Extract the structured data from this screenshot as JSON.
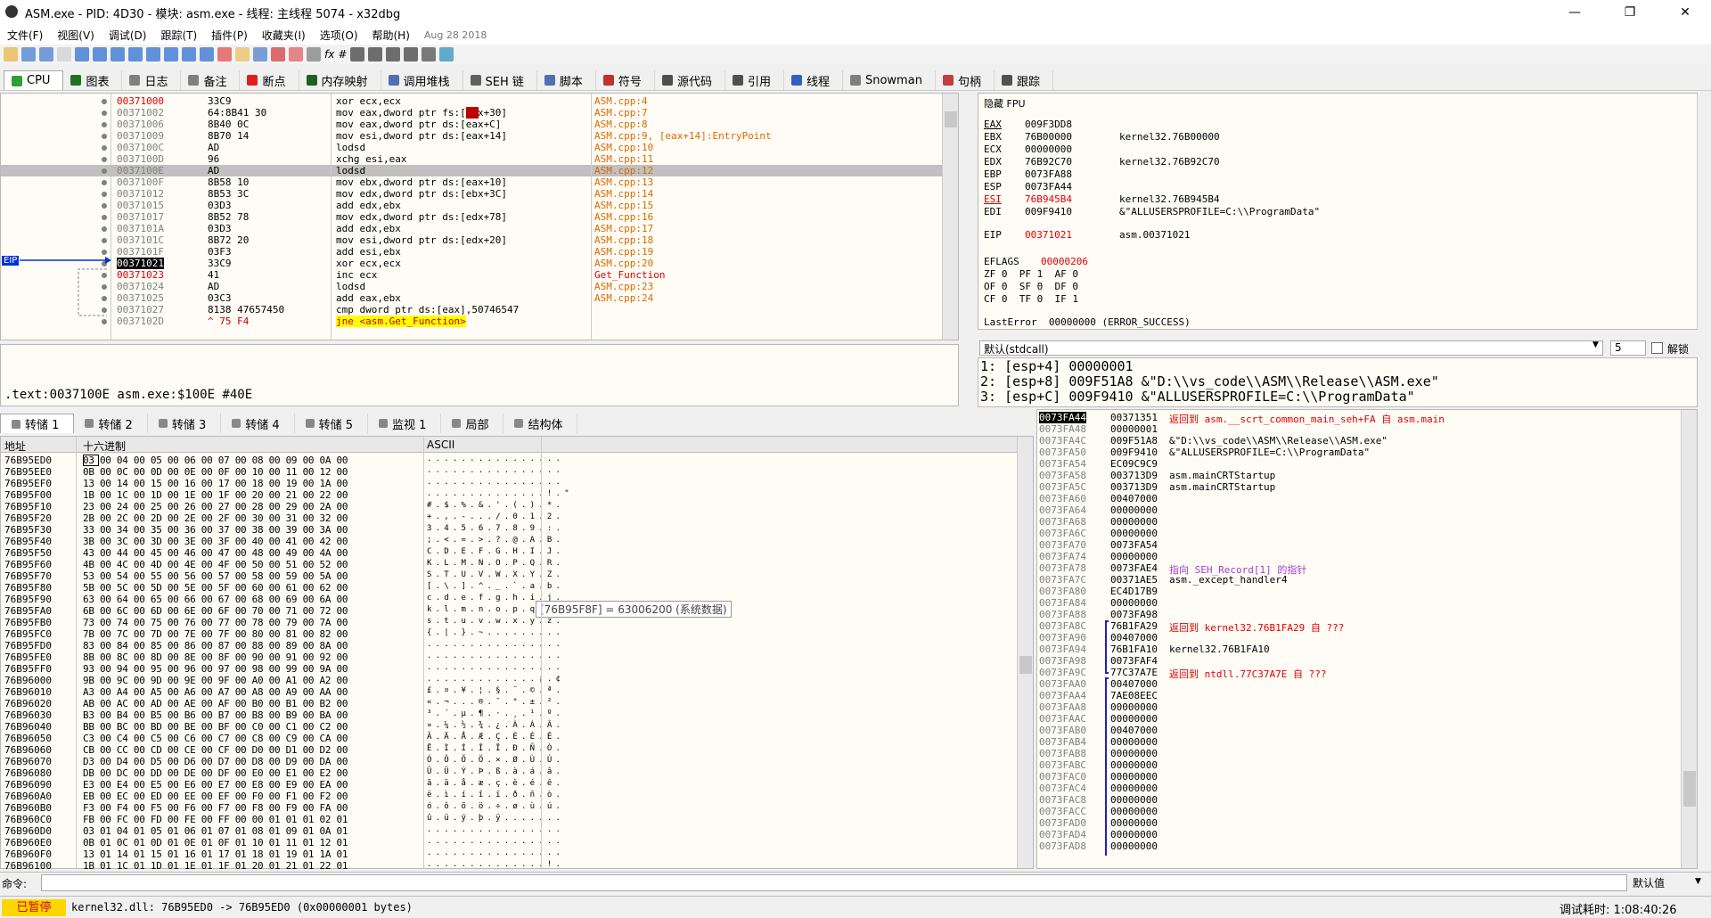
{
  "window": {
    "title": "ASM.exe - PID: 4D30 - 模块: asm.exe - 线程: 主线程 5074 - x32dbg",
    "min": "—",
    "max": "❐",
    "close": "✕"
  },
  "menu": {
    "items": [
      "文件(F)",
      "视图(V)",
      "调试(D)",
      "跟踪(T)",
      "插件(P)",
      "收藏夹(I)",
      "选项(O)",
      "帮助(H)"
    ],
    "date": "Aug 28 2018"
  },
  "toolbar": {
    "colors": [
      "#e8b44c",
      "#4a7fd0",
      "#4a7fd0",
      "#d0d0d0",
      "#3070d0",
      "#3070d0",
      "#3070d0",
      "#3070d0",
      "#3070d0",
      "#3070d0",
      "#3070d0",
      "#3070d0",
      "#e05050",
      "#e8c060",
      "#5080d0",
      "#d04040",
      "#e06060",
      "#808080",
      "#404040",
      "#404040",
      "#404040",
      "#404040",
      "#505050",
      "#3090c0"
    ],
    "glyphs": {
      "fx": "fx",
      "hash": "#",
      "az": "Aᵦ"
    }
  },
  "tabs": [
    {
      "label": "CPU",
      "icon": "cpu-icon",
      "color": "#30a030"
    },
    {
      "label": "图表",
      "icon": "graph-icon",
      "color": "#207020"
    },
    {
      "label": "日志",
      "icon": "log-icon",
      "color": "#808080"
    },
    {
      "label": "备注",
      "icon": "notes-icon",
      "color": "#808080"
    },
    {
      "label": "断点",
      "icon": "breakpoint-icon",
      "color": "#e02020"
    },
    {
      "label": "内存映射",
      "icon": "memory-map-icon",
      "color": "#206020"
    },
    {
      "label": "调用堆栈",
      "icon": "call-stack-icon",
      "color": "#5070b0"
    },
    {
      "label": "SEH 链",
      "icon": "seh-icon",
      "color": "#606060"
    },
    {
      "label": "脚本",
      "icon": "script-icon",
      "color": "#5070b0"
    },
    {
      "label": "符号",
      "icon": "symbols-icon",
      "color": "#c03030"
    },
    {
      "label": "源代码",
      "icon": "source-icon",
      "color": "#505050"
    },
    {
      "label": "引用",
      "icon": "references-icon",
      "color": "#505050"
    },
    {
      "label": "线程",
      "icon": "threads-icon",
      "color": "#3060c0"
    },
    {
      "label": "Snowman",
      "icon": "snowman-icon",
      "color": "#808080"
    },
    {
      "label": "句柄",
      "icon": "handles-icon",
      "color": "#c04040"
    },
    {
      "label": "跟踪",
      "icon": "trace-icon",
      "color": "#505050"
    }
  ],
  "eip_label": "EIP",
  "disasm": [
    {
      "addr": "00371000",
      "bytes": "33C9",
      "instr": "xor ecx,ecx",
      "com": "ASM.cpp:4",
      "red": true
    },
    {
      "addr": "00371002",
      "bytes": "64:8B41 30",
      "instr": "mov eax,dword ptr fs:[ecx+30]",
      "com": "ASM.cpp:7"
    },
    {
      "addr": "00371006",
      "bytes": "8B40 0C",
      "instr": "mov eax,dword ptr ds:[eax+C]",
      "com": "ASM.cpp:8"
    },
    {
      "addr": "00371009",
      "bytes": "8B70 14",
      "instr": "mov esi,dword ptr ds:[eax+14]",
      "com": "ASM.cpp:9, [eax+14]:EntryPoint"
    },
    {
      "addr": "0037100C",
      "bytes": "AD",
      "instr": "lodsd",
      "com": "ASM.cpp:10"
    },
    {
      "addr": "0037100D",
      "bytes": "96",
      "instr": "xchg esi,eax",
      "com": "ASM.cpp:11"
    },
    {
      "addr": "0037100E",
      "bytes": "AD",
      "instr": "lodsd",
      "com": "ASM.cpp:12",
      "sel": true
    },
    {
      "addr": "0037100F",
      "bytes": "8B58 10",
      "instr": "mov ebx,dword ptr ds:[eax+10]",
      "com": "ASM.cpp:13"
    },
    {
      "addr": "00371012",
      "bytes": "8B53 3C",
      "instr": "mov edx,dword ptr ds:[ebx+3C]",
      "com": "ASM.cpp:14"
    },
    {
      "addr": "00371015",
      "bytes": "03D3",
      "instr": "add edx,ebx",
      "com": "ASM.cpp:15"
    },
    {
      "addr": "00371017",
      "bytes": "8B52 78",
      "instr": "mov edx,dword ptr ds:[edx+78]",
      "com": "ASM.cpp:16"
    },
    {
      "addr": "0037101A",
      "bytes": "03D3",
      "instr": "add edx,ebx",
      "com": "ASM.cpp:17"
    },
    {
      "addr": "0037101C",
      "bytes": "8B72 20",
      "instr": "mov esi,dword ptr ds:[edx+20]",
      "com": "ASM.cpp:18"
    },
    {
      "addr": "0037101F",
      "bytes": "03F3",
      "instr": "add esi,ebx",
      "com": "ASM.cpp:19"
    },
    {
      "addr": "00371021",
      "bytes": "33C9",
      "instr": "xor ecx,ecx",
      "com": "ASM.cpp:20",
      "eip": true
    },
    {
      "addr": "00371023",
      "bytes": "41",
      "instr": "inc ecx",
      "com": "Get_Function",
      "red": true
    },
    {
      "addr": "00371024",
      "bytes": "AD",
      "instr": "lodsd",
      "com": "ASM.cpp:23"
    },
    {
      "addr": "00371025",
      "bytes": "03C3",
      "instr": "add eax,ebx",
      "com": "ASM.cpp:24"
    },
    {
      "addr": "00371027",
      "bytes": "8138 47657450",
      "instr": "cmp dword ptr ds:[eax],50746547",
      "com": ""
    },
    {
      "addr": "0037102D",
      "bytes": "^ 75 F4",
      "instr": "jne <asm.Get_Function>",
      "com": "",
      "jump": true
    }
  ],
  "regs": {
    "header": "隐藏 FPU",
    "rows": [
      {
        "n": "EAX",
        "v": "009F3DD8",
        "c": ""
      },
      {
        "n": "EBX",
        "v": "76B00000",
        "c": "kernel32.76B00000"
      },
      {
        "n": "ECX",
        "v": "00000000",
        "c": ""
      },
      {
        "n": "EDX",
        "v": "76B92C70",
        "c": "kernel32.76B92C70"
      },
      {
        "n": "EBP",
        "v": "0073FA88",
        "c": ""
      },
      {
        "n": "ESP",
        "v": "0073FA44",
        "c": ""
      },
      {
        "n": "ESI",
        "v": "76B945B4",
        "c": "kernel32.76B945B4",
        "red": true
      },
      {
        "n": "EDI",
        "v": "009F9410",
        "c": "&\"ALLUSERSPROFILE=C:\\\\ProgramData\""
      }
    ],
    "eip": {
      "n": "EIP",
      "v": "00371021",
      "c": "asm.00371021"
    },
    "eflags": {
      "n": "EFLAGS",
      "v": "00000206"
    },
    "flags": [
      "ZF 0  PF 1  AF 0",
      "OF 0  SF 0  DF 0",
      "CF 0  TF 0  IF 1"
    ],
    "lasterror": "LastError  00000000 (ERROR_SUCCESS)"
  },
  "callconv": {
    "value": "默认(stdcall)",
    "count": "5",
    "lock": "解锁"
  },
  "args": [
    "1: [esp+4] 00000001",
    "2: [esp+8] 009F51A8 &\"D:\\\\vs_code\\\\ASM\\\\Release\\\\ASM.exe\"",
    "3: [esp+C] 009F9410 &\"ALLUSERSPROFILE=C:\\\\ProgramData\""
  ],
  "info": ".text:0037100E asm.exe:$100E #40E",
  "dumptabs": [
    {
      "label": "转储 1",
      "icon": "dump-icon"
    },
    {
      "label": "转储 2",
      "icon": "dump-icon"
    },
    {
      "label": "转储 3",
      "icon": "dump-icon"
    },
    {
      "label": "转储 4",
      "icon": "dump-icon"
    },
    {
      "label": "转储 5",
      "icon": "dump-icon"
    },
    {
      "label": "监视 1",
      "icon": "watch-icon"
    },
    {
      "label": "局部",
      "icon": "locals-icon"
    },
    {
      "label": "结构体",
      "icon": "struct-icon"
    }
  ],
  "dump": {
    "headers": {
      "addr": "地址",
      "hex": "十六进制",
      "ascii": "ASCII"
    },
    "tooltip": "[76B95F8F] = 63006200 (系统数据)",
    "rows": [
      [
        "76B95ED0",
        "03 00 04 00 05 00 06 00 07 00 08 00 09 00 0A 00",
        ". . . . . . . . . . . . . . . ."
      ],
      [
        "76B95EE0",
        "0B 00 0C 00 0D 00 0E 00 0F 00 10 00 11 00 12 00",
        ". . . . . . . . . . . . . . . ."
      ],
      [
        "76B95EF0",
        "13 00 14 00 15 00 16 00 17 00 18 00 19 00 1A 00",
        ". . . . . . . . . . . . . . . ."
      ],
      [
        "76B95F00",
        "1B 00 1C 00 1D 00 1E 00 1F 00 20 00 21 00 22 00",
        ". . . . . . . . . . . . . . ! . \""
      ],
      [
        "76B95F10",
        "23 00 24 00 25 00 26 00 27 00 28 00 29 00 2A 00",
        "# . $ . % . & . ' . ( . ) . * ."
      ],
      [
        "76B95F20",
        "2B 00 2C 00 2D 00 2E 00 2F 00 30 00 31 00 32 00",
        "+ . , . - . . . / . 0 . 1 . 2 ."
      ],
      [
        "76B95F30",
        "33 00 34 00 35 00 36 00 37 00 38 00 39 00 3A 00",
        "3 . 4 . 5 . 6 . 7 . 8 . 9 . : ."
      ],
      [
        "76B95F40",
        "3B 00 3C 00 3D 00 3E 00 3F 00 40 00 41 00 42 00",
        "; . < . = . > . ? . @ . A . B ."
      ],
      [
        "76B95F50",
        "43 00 44 00 45 00 46 00 47 00 48 00 49 00 4A 00",
        "C . D . E . F . G . H . I . J ."
      ],
      [
        "76B95F60",
        "4B 00 4C 00 4D 00 4E 00 4F 00 50 00 51 00 52 00",
        "K . L . M . N . O . P . Q . R ."
      ],
      [
        "76B95F70",
        "53 00 54 00 55 00 56 00 57 00 58 00 59 00 5A 00",
        "S . T . U . V . W . X . Y . Z ."
      ],
      [
        "76B95F80",
        "5B 00 5C 00 5D 00 5E 00 5F 00 60 00 61 00 62 00",
        "[ . \\ . ] . ^ . _ . ` . a . b ."
      ],
      [
        "76B95F90",
        "63 00 64 00 65 00 66 00 67 00 68 00 69 00 6A 00",
        "c . d . e . f . g . h . i . j ."
      ],
      [
        "76B95FA0",
        "6B 00 6C 00 6D 00 6E 00 6F 00 70 00 71 00 72 00",
        "k . l . m . n . o . p . q . r ."
      ],
      [
        "76B95FB0",
        "73 00 74 00 75 00 76 00 77 00 78 00 79 00 7A 00",
        "s . t . u . v . w . x . y . z ."
      ],
      [
        "76B95FC0",
        "7B 00 7C 00 7D 00 7E 00 7F 00 80 00 81 00 82 00",
        "{ . | . } . ~ . . . . . . . . ."
      ],
      [
        "76B95FD0",
        "83 00 84 00 85 00 86 00 87 00 88 00 89 00 8A 00",
        ". . . . . . . . . . . . . . . ."
      ],
      [
        "76B95FE0",
        "8B 00 8C 00 8D 00 8E 00 8F 00 90 00 91 00 92 00",
        ". . . . . . . . . . . . . . . ."
      ],
      [
        "76B95FF0",
        "93 00 94 00 95 00 96 00 97 00 98 00 99 00 9A 00",
        ". . . . . . . . . . . . . . . ."
      ],
      [
        "76B96000",
        "9B 00 9C 00 9D 00 9E 00 9F 00 A0 00 A1 00 A2 00",
        ". . . . . . . . . . . . . ¡ . ¢"
      ],
      [
        "76B96010",
        "A3 00 A4 00 A5 00 A6 00 A7 00 A8 00 A9 00 AA 00",
        "£ . ¤ . ¥ . ¦ . § . ¨ . © . ª ."
      ],
      [
        "76B96020",
        "AB 00 AC 00 AD 00 AE 00 AF 00 B0 00 B1 00 B2 00",
        "« . ¬ . . . ® . ¯ . ° . ± . ² ."
      ],
      [
        "76B96030",
        "B3 00 B4 00 B5 00 B6 00 B7 00 B8 00 B9 00 BA 00",
        "³ . ´ . µ . ¶ . · . ¸ . ¹ . º ."
      ],
      [
        "76B96040",
        "BB 00 BC 00 BD 00 BE 00 BF 00 C0 00 C1 00 C2 00",
        "» . ¼ . ½ . ¾ . ¿ . À . Á . Â ."
      ],
      [
        "76B96050",
        "C3 00 C4 00 C5 00 C6 00 C7 00 C8 00 C9 00 CA 00",
        "Ã . Ä . Å . Æ . Ç . È . É . Ê ."
      ],
      [
        "76B96060",
        "CB 00 CC 00 CD 00 CE 00 CF 00 D0 00 D1 00 D2 00",
        "Ë . Ì . Í . Î . Ï . Ð . Ñ . Ò ."
      ],
      [
        "76B96070",
        "D3 00 D4 00 D5 00 D6 00 D7 00 D8 00 D9 00 DA 00",
        "Ó . Ô . Õ . Ö . × . Ø . Ù . Ú ."
      ],
      [
        "76B96080",
        "DB 00 DC 00 DD 00 DE 00 DF 00 E0 00 E1 00 E2 00",
        "Û . Ü . Ý . Þ . ß . à . á . â ."
      ],
      [
        "76B96090",
        "E3 00 E4 00 E5 00 E6 00 E7 00 E8 00 E9 00 EA 00",
        "ã . ä . å . æ . ç . è . é . ê ."
      ],
      [
        "76B960A0",
        "EB 00 EC 00 ED 00 EE 00 EF 00 F0 00 F1 00 F2 00",
        "ë . ì . í . î . ï . ð . ñ . ò ."
      ],
      [
        "76B960B0",
        "F3 00 F4 00 F5 00 F6 00 F7 00 F8 00 F9 00 FA 00",
        "ó . ô . õ . ö . ÷ . ø . ù . ú ."
      ],
      [
        "76B960C0",
        "FB 00 FC 00 FD 00 FE 00 FF 00 00 01 01 01 02 01",
        "û . ü . ý . þ . ÿ . . . . . . ."
      ],
      [
        "76B960D0",
        "03 01 04 01 05 01 06 01 07 01 08 01 09 01 0A 01",
        ". . . . . . . . . . . . . . . ."
      ],
      [
        "76B960E0",
        "0B 01 0C 01 0D 01 0E 01 0F 01 10 01 11 01 12 01",
        ". . . . . . . . . . . . . . . ."
      ],
      [
        "76B960F0",
        "13 01 14 01 15 01 16 01 17 01 18 01 19 01 1A 01",
        ". . . . . . . . . . . . . . . ."
      ],
      [
        "76B96100",
        "1B 01 1C 01 1D 01 1E 01 1F 01 20 01 21 01 22 01",
        ". . . . . . . . . . . . . . ! ."
      ]
    ]
  },
  "stack": [
    {
      "a": "0073FA44",
      "v": "00371351",
      "c": "返回到 asm.__scrt_common_main_seh+FA 自 asm.main",
      "t": "ret",
      "sel": true
    },
    {
      "a": "0073FA48",
      "v": "00000001",
      "c": ""
    },
    {
      "a": "0073FA4C",
      "v": "009F51A8",
      "c": "&\"D:\\\\vs_code\\\\ASM\\\\Release\\\\ASM.exe\""
    },
    {
      "a": "0073FA50",
      "v": "009F9410",
      "c": "&\"ALLUSERSPROFILE=C:\\\\ProgramData\""
    },
    {
      "a": "0073FA54",
      "v": "EC09C9C9",
      "c": ""
    },
    {
      "a": "0073FA58",
      "v": "003713D9",
      "c": "asm.mainCRTStartup"
    },
    {
      "a": "0073FA5C",
      "v": "003713D9",
      "c": "asm.mainCRTStartup"
    },
    {
      "a": "0073FA60",
      "v": "00407000",
      "c": ""
    },
    {
      "a": "0073FA64",
      "v": "00000000",
      "c": ""
    },
    {
      "a": "0073FA68",
      "v": "00000000",
      "c": ""
    },
    {
      "a": "0073FA6C",
      "v": "00000000",
      "c": ""
    },
    {
      "a": "0073FA70",
      "v": "0073FA54",
      "c": ""
    },
    {
      "a": "0073FA74",
      "v": "00000000",
      "c": ""
    },
    {
      "a": "0073FA78",
      "v": "0073FAE4",
      "c": "指向 SEH_Record[1] 的指针",
      "t": "seh"
    },
    {
      "a": "0073FA7C",
      "v": "00371AE5",
      "c": "asm._except_handler4"
    },
    {
      "a": "0073FA80",
      "v": "EC4D17B9",
      "c": ""
    },
    {
      "a": "0073FA84",
      "v": "00000000",
      "c": ""
    },
    {
      "a": "0073FA88",
      "v": "0073FA98",
      "c": ""
    },
    {
      "a": "0073FA8C",
      "v": "76B1FA29",
      "c": "返回到 kernel32.76B1FA29 自 ???",
      "t": "ret"
    },
    {
      "a": "0073FA90",
      "v": "00407000",
      "c": ""
    },
    {
      "a": "0073FA94",
      "v": "76B1FA10",
      "c": "kernel32.76B1FA10"
    },
    {
      "a": "0073FA98",
      "v": "0073FAF4",
      "c": ""
    },
    {
      "a": "0073FA9C",
      "v": "77C37A7E",
      "c": "返回到 ntdll.77C37A7E 自 ???",
      "t": "ret"
    },
    {
      "a": "0073FAA0",
      "v": "00407000",
      "c": ""
    },
    {
      "a": "0073FAA4",
      "v": "7AE08EEC",
      "c": ""
    },
    {
      "a": "0073FAA8",
      "v": "00000000",
      "c": ""
    },
    {
      "a": "0073FAAC",
      "v": "00000000",
      "c": ""
    },
    {
      "a": "0073FAB0",
      "v": "00407000",
      "c": ""
    },
    {
      "a": "0073FAB4",
      "v": "00000000",
      "c": ""
    },
    {
      "a": "0073FAB8",
      "v": "00000000",
      "c": ""
    },
    {
      "a": "0073FABC",
      "v": "00000000",
      "c": ""
    },
    {
      "a": "0073FAC0",
      "v": "00000000",
      "c": ""
    },
    {
      "a": "0073FAC4",
      "v": "00000000",
      "c": ""
    },
    {
      "a": "0073FAC8",
      "v": "00000000",
      "c": ""
    },
    {
      "a": "0073FACC",
      "v": "00000000",
      "c": ""
    },
    {
      "a": "0073FAD0",
      "v": "00000000",
      "c": ""
    },
    {
      "a": "0073FAD4",
      "v": "00000000",
      "c": ""
    },
    {
      "a": "0073FAD8",
      "v": "00000000",
      "c": ""
    }
  ],
  "cmd": {
    "label": "命令:",
    "value": "",
    "default": "默认值"
  },
  "status": {
    "state": "已暂停",
    "text": "kernel32.dll: 76B95ED0 -> 76B95ED0 (0x00000001 bytes)",
    "time": "调试耗时: 1:08:40:26"
  }
}
